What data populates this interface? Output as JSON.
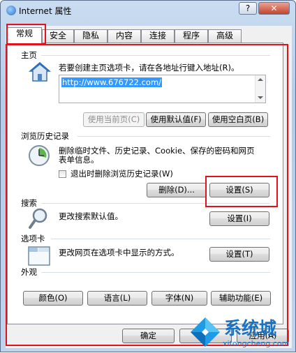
{
  "window": {
    "title": "Internet 属性"
  },
  "titlebar_buttons": {
    "help": "?",
    "close": "✕"
  },
  "tabs": [
    {
      "label": "常规"
    },
    {
      "label": "安全"
    },
    {
      "label": "隐私"
    },
    {
      "label": "内容"
    },
    {
      "label": "连接"
    },
    {
      "label": "程序"
    },
    {
      "label": "高级"
    }
  ],
  "homepage": {
    "section_title": "主页",
    "description": "若要创建主页选项卡，请在各地址行键入地址(R)。",
    "url_value": "http://www.676722.com/",
    "use_current": "使用当前页(C)",
    "use_default": "使用默认值(F)",
    "use_blank": "使用空白页(B)"
  },
  "history": {
    "section_title": "浏览历史记录",
    "description_line1": "删除临时文件、历史记录、Cookie、保存的密码和网页",
    "description_line2": "表单信息。",
    "checkbox_label": "退出时删除浏览历史记录(W)",
    "delete_button": "删除(D)...",
    "settings_button": "设置(S)"
  },
  "search": {
    "section_title": "搜索",
    "description": "更改搜索默认值。",
    "settings_button": "设置(I)"
  },
  "tabs_section": {
    "section_title": "选项卡",
    "description": "更改网页在选项卡中显示的方式。",
    "settings_button": "设置(T)"
  },
  "appearance": {
    "section_title": "外观",
    "colors_button": "颜色(O)",
    "languages_button": "语言(L)",
    "fonts_button": "字体(N)",
    "accessibility_button": "辅助功能(E)"
  },
  "footer": {
    "ok": "确定",
    "cancel": "取消",
    "apply": "应用(A)"
  },
  "watermark": {
    "brand": "系统城",
    "site": "xitongcheng.com"
  },
  "colors": {
    "highlight_red": "#e0121c",
    "selection_blue": "#3399ff",
    "title_blue": "#b9cfe8"
  }
}
